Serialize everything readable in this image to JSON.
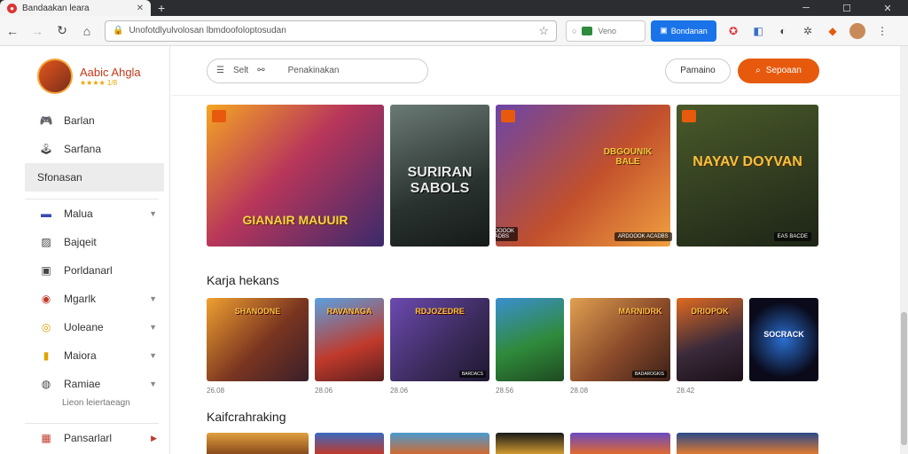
{
  "browser": {
    "tab_title": "Bandaakan leara",
    "url": "Unofotdlyulvolosan lbmdoofoloptosudan",
    "ext_text": "Veno",
    "blue_button": "Bondanan"
  },
  "sidebar": {
    "profile_name": "Aabic Ahgla",
    "profile_rating": "★★★★ 1/8",
    "items": [
      {
        "label": "Barlan"
      },
      {
        "label": "Sarfana"
      },
      {
        "label": "Sfonasan"
      },
      {
        "label": "Malua"
      },
      {
        "label": "Bajqeit"
      },
      {
        "label": "Porldanarl"
      },
      {
        "label": "Mgarlk"
      },
      {
        "label": "Uoleane"
      },
      {
        "label": "Maiora"
      },
      {
        "label": "Ramiae"
      },
      {
        "label": "Pansarlarl"
      }
    ],
    "subtext": "Lieon leiertaeagn"
  },
  "main": {
    "search_label": "Selt",
    "search_placeholder": "Penakinakan",
    "outline_button": "Pamaino",
    "orange_button": "Sepoaan",
    "heroes": [
      {
        "title": "GIANAIR MAUUIR",
        "tag": ""
      },
      {
        "title": "SURIRAN SABOLS",
        "tag": ""
      },
      {
        "title": "DBGOUNIK BALE",
        "tag": "ARDOOOK ACADBS"
      },
      {
        "title": "NAYAV DOYVAN",
        "tag": "EAS BACDE"
      }
    ],
    "section1": "Karja hekans",
    "thumbs": [
      {
        "title": "SHANODNE",
        "caption": "26.08",
        "tag": ""
      },
      {
        "title": "RAVANAGA",
        "caption": "28.06",
        "tag": ""
      },
      {
        "title": "RDJOZEDRE",
        "caption": "28.06",
        "tag": "BARDACS"
      },
      {
        "title": "",
        "caption": "28.56",
        "tag": ""
      },
      {
        "title": "MARNIDRK",
        "caption": "28.08",
        "tag": "BADAROGKIS"
      },
      {
        "title": "DRIOPOK",
        "caption": "28.42",
        "tag": ""
      },
      {
        "title": "SOCRACK",
        "caption": "",
        "tag": ""
      }
    ],
    "section2": "Kaifcrahraking"
  },
  "colors": {
    "accent": "#e75a0d",
    "brand_blue": "#1a73e8"
  }
}
